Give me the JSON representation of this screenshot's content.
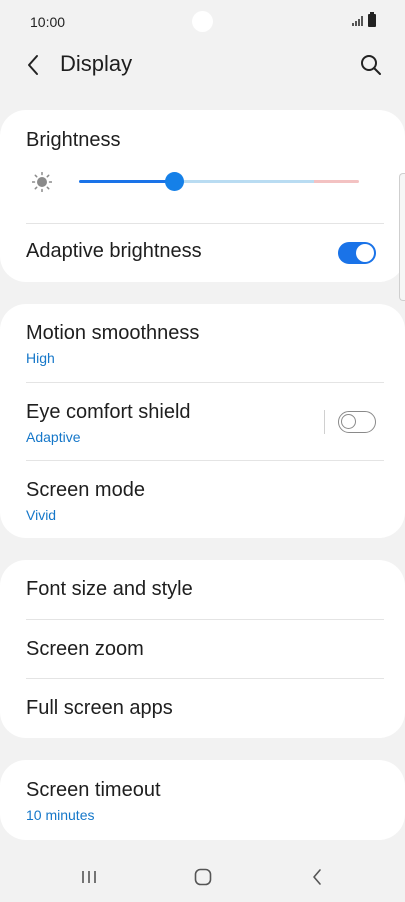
{
  "status_bar": {
    "time": "10:00"
  },
  "header": {
    "title": "Display"
  },
  "brightness_card": {
    "title": "Brightness",
    "brightness_level": 0.34,
    "adaptive_label": "Adaptive brightness",
    "adaptive_on": true
  },
  "display_card": {
    "motion_title": "Motion smoothness",
    "motion_value": "High",
    "eye_title": "Eye comfort shield",
    "eye_value": "Adaptive",
    "eye_on": false,
    "mode_title": "Screen mode",
    "mode_value": "Vivid"
  },
  "font_card": {
    "font_title": "Font size and style",
    "zoom_title": "Screen zoom",
    "fullscreen_title": "Full screen apps"
  },
  "timeout_card": {
    "title": "Screen timeout",
    "value": "10 minutes"
  },
  "colors": {
    "accent": "#1a73e8",
    "subtext": "#1577c9",
    "background": "#f2f2f2"
  }
}
